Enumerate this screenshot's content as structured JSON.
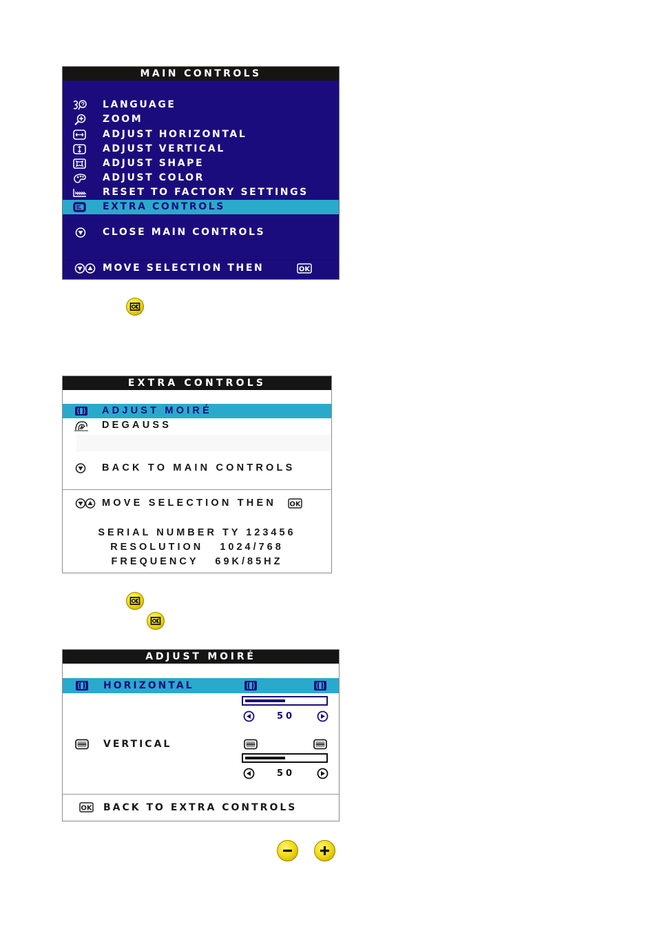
{
  "colors": {
    "panel_blue": "#1b0c7e",
    "highlight": "#2aaacb",
    "title_bar": "#171514",
    "button_yellow": "#f2dc10"
  },
  "main_controls": {
    "title": "MAIN CONTROLS",
    "items": [
      {
        "label": "LANGUAGE",
        "icon": "language-icon"
      },
      {
        "label": "ZOOM",
        "icon": "zoom-icon"
      },
      {
        "label": "ADJUST HORIZONTAL",
        "icon": "adjust-horizontal-icon"
      },
      {
        "label": "ADJUST VERTICAL",
        "icon": "adjust-vertical-icon"
      },
      {
        "label": "ADJUST SHAPE",
        "icon": "adjust-shape-icon"
      },
      {
        "label": "ADJUST COLOR",
        "icon": "palette-icon"
      },
      {
        "label": "RESET TO FACTORY SETTINGS",
        "icon": "factory-icon"
      },
      {
        "label": "EXTRA CONTROLS",
        "icon": "extra-controls-icon",
        "selected": true
      }
    ],
    "close_label": "CLOSE MAIN CONTROLS",
    "footer_label": "MOVE SELECTION THEN",
    "footer_ok": "OK"
  },
  "ok_button_1": {
    "icon": "ok-button-icon"
  },
  "extra_controls": {
    "title": "EXTRA CONTROLS",
    "items": [
      {
        "label": "ADJUST MOIRÉ",
        "icon": "moire-icon",
        "selected": true
      },
      {
        "label": "DEGAUSS",
        "icon": "degauss-icon"
      }
    ],
    "back_label": "BACK TO MAIN CONTROLS",
    "footer_label": "MOVE SELECTION THEN",
    "info": {
      "serial": "SERIAL NUMBER TY 123456",
      "resolution": "RESOLUTION   1024/768",
      "frequency": "FREQUENCY   69K/85HZ"
    }
  },
  "ok_buttons_2": [
    {
      "icon": "ok-button-icon"
    },
    {
      "icon": "ok-button-icon"
    }
  ],
  "adjust_moire": {
    "title": "ADJUST MOIRÉ",
    "horizontal": {
      "label": "HORIZONTAL",
      "value": "50",
      "level_percent": 50,
      "selected": true
    },
    "vertical": {
      "label": "VERTICAL",
      "value": "50",
      "level_percent": 50
    },
    "back_label": "BACK TO EXTRA CONTROLS"
  },
  "adjust_buttons": {
    "minus": "minus-button",
    "plus": "plus-button"
  }
}
